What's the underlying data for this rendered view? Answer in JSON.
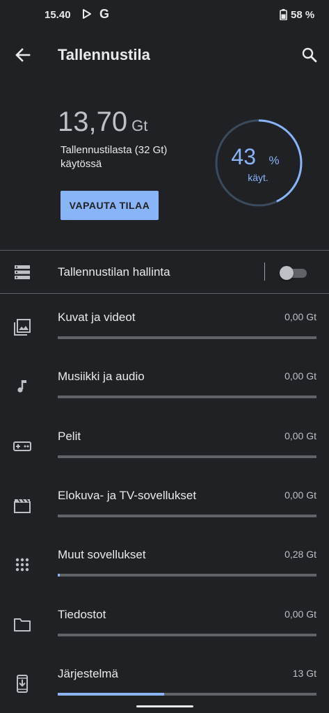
{
  "status_bar": {
    "time": "15.40",
    "g_label": "G",
    "battery": "58 %"
  },
  "app_bar": {
    "title": "Tallennustila"
  },
  "summary": {
    "used_value": "13,70",
    "used_unit": "Gt",
    "description": "Tallennustilasta (32 Gt) käytössä",
    "percent": "43",
    "percent_sign": "%",
    "percent_label": "käyt.",
    "fraction_used": 0.43,
    "free_button": "VAPAUTA TILAA"
  },
  "storage_manager": {
    "label": "Tallennustilan hallinta",
    "enabled": false
  },
  "categories": [
    {
      "name": "photos-videos",
      "icon": "photo-library-icon",
      "label": "Kuvat ja videot",
      "size": "0,00 Gt",
      "fraction": 0
    },
    {
      "name": "music-audio",
      "icon": "music-note-icon",
      "label": "Musiikki ja audio",
      "size": "0,00 Gt",
      "fraction": 0
    },
    {
      "name": "games",
      "icon": "gamepad-icon",
      "label": "Pelit",
      "size": "0,00 Gt",
      "fraction": 0
    },
    {
      "name": "movies-tv",
      "icon": "movie-icon",
      "label": "Elokuva- ja TV-sovellukset",
      "size": "0,00 Gt",
      "fraction": 0
    },
    {
      "name": "other-apps",
      "icon": "apps-grid-icon",
      "label": "Muut sovellukset",
      "size": "0,28 Gt",
      "fraction": 0.009
    },
    {
      "name": "files",
      "icon": "folder-icon",
      "label": "Tiedostot",
      "size": "0,00 Gt",
      "fraction": 0
    },
    {
      "name": "system",
      "icon": "system-update-icon",
      "label": "Järjestelmä",
      "size": "13 Gt",
      "fraction": 0.41
    }
  ],
  "colors": {
    "accent": "#8ab4f8",
    "background": "#202124",
    "track": "#5f6368"
  }
}
